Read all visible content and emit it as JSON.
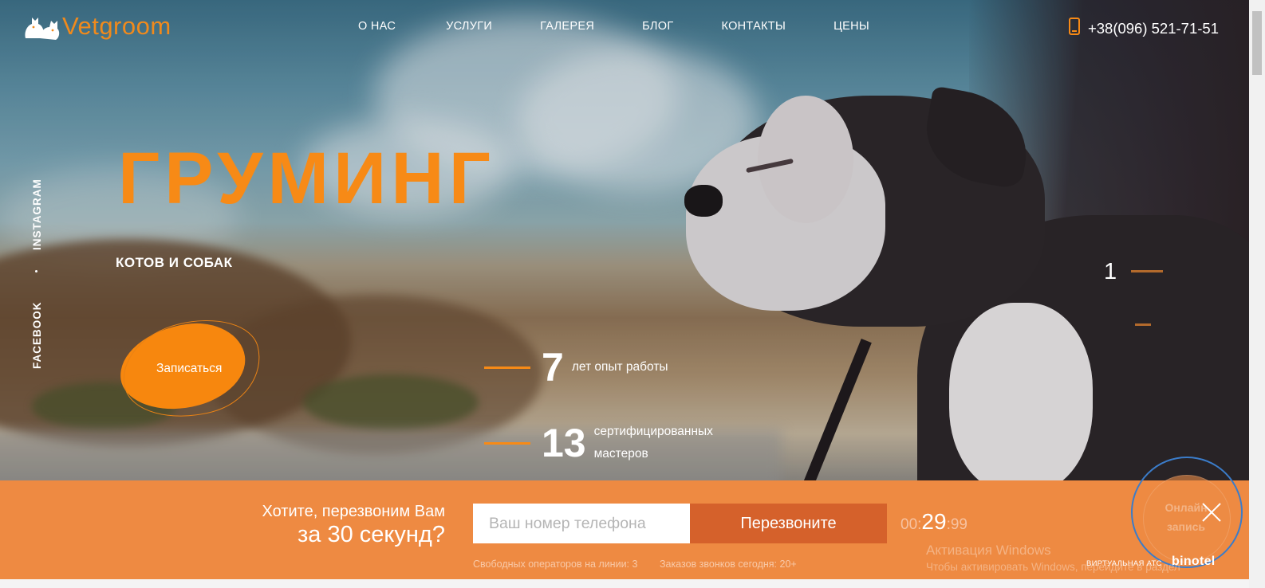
{
  "brand": {
    "name": "Vetgroom",
    "accent": "#f78a16"
  },
  "nav": {
    "items": [
      "О НАС",
      "УСЛУГИ",
      "ГАЛЕРЕЯ",
      "БЛОГ",
      "КОНТАКТЫ",
      "ЦЕНЫ"
    ]
  },
  "header": {
    "phone": "+38(096) 521-71-51",
    "phone_icon": "mobile-phone-icon"
  },
  "social": {
    "instagram": "INSTAGRAM",
    "facebook": "FACEBOOK"
  },
  "hero": {
    "title": "ГРУМИНГ",
    "subtitle": "КОТОВ И СОБАК",
    "cta_label": "Записаться",
    "slide_number": "1"
  },
  "stats": [
    {
      "number": "7",
      "text_lines": [
        "лет опыт работы"
      ]
    },
    {
      "number": "13",
      "text_lines": [
        "сертифицированных",
        "мастеров"
      ]
    }
  ],
  "callback": {
    "question_line1": "Хотите, перезвоним Вам",
    "question_line2": "за 30 секунд?",
    "phone_placeholder": "Ваш номер телефона",
    "button_label": "Перезвоните",
    "timer_prefix": "00:",
    "timer_seconds": "29",
    "timer_suffix": ":99",
    "operators_text": "Свободных операторов на линии: 3",
    "calls_text": "Заказов звонков сегодня: 20+",
    "online_text_line1": "Онлайн",
    "online_text_line2": "запись",
    "virtual_ats": "ВИРТУАЛЬНАЯ АТС",
    "binotel": "binotel",
    "close_icon": "close-icon",
    "colors": {
      "bar": "#ee8a42",
      "button": "#d5612b"
    }
  },
  "windows_activation": {
    "title": "Активация Windows",
    "text": "Чтобы активировать Windows, перейдите в раздел"
  }
}
